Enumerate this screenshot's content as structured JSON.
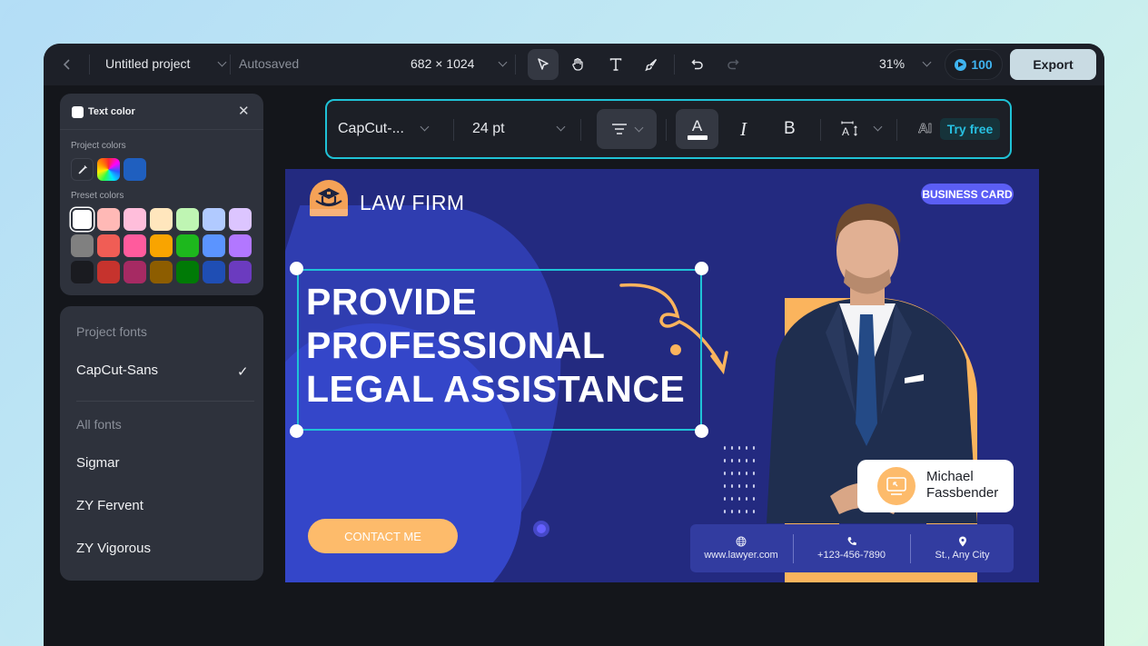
{
  "topbar": {
    "back_label": "‹",
    "project_title": "Untitled project",
    "save_status": "Autosaved",
    "canvas_size": "682 × 1024",
    "tools": [
      {
        "name": "select",
        "icon": "cursor-icon"
      },
      {
        "name": "hand",
        "icon": "hand-icon"
      },
      {
        "name": "text",
        "icon": "text-icon"
      },
      {
        "name": "draw",
        "icon": "brush-icon"
      },
      {
        "name": "undo",
        "icon": "undo-icon"
      },
      {
        "name": "redo",
        "icon": "redo-icon"
      }
    ],
    "zoom_level": "31%",
    "credits": "100",
    "export_label": "Export"
  },
  "text_toolbar": {
    "font": "CapCut-...",
    "size": "24 pt",
    "ai_label": "AI",
    "try_free": "Try free",
    "italic_label": "I",
    "bold_label": "B",
    "color_label": "A"
  },
  "color_panel": {
    "title": "Text color",
    "close": "✕",
    "project_colors_label": "Project colors",
    "project_colors": [
      "eyedropper",
      "gradient",
      "#1f5fbf"
    ],
    "preset_colors_label": "Preset colors",
    "preset_colors": [
      [
        "#ffffff",
        "#ffb9b6",
        "#ffbedb",
        "#ffe6bd",
        "#bff5b3",
        "#b1caff",
        "#dcc5ff"
      ],
      [
        "#808080",
        "#f05d55",
        "#ff5b9d",
        "#f9a400",
        "#1db81d",
        "#5b94ff",
        "#b277ff"
      ],
      [
        "#1a1b20",
        "#c6332d",
        "#a62a63",
        "#8d5d00",
        "#007a06",
        "#1f4eb4",
        "#6b3bbf"
      ]
    ],
    "selected": "#ffffff"
  },
  "font_panel": {
    "project_fonts_label": "Project fonts",
    "project_fonts": [
      {
        "name": "CapCut-Sans",
        "selected": true
      }
    ],
    "all_fonts_label": "All fonts",
    "all_fonts": [
      "Sigmar",
      "ZY Fervent",
      "ZY Vigorous"
    ],
    "check": "✓"
  },
  "canvas": {
    "brand": "LAW FIRM",
    "badge": "BUSINESS CARD",
    "headline": [
      "PROVIDE",
      "PROFESSIONAL",
      "LEGAL ASSISTANCE"
    ],
    "cta": "CONTACT ME",
    "person_name": [
      "Michael",
      "Fassbender"
    ],
    "contacts": [
      {
        "icon": "globe-icon",
        "text": "www.lawyer.com"
      },
      {
        "icon": "phone-icon",
        "text": "+123-456-7890"
      },
      {
        "icon": "location-pin-icon",
        "text": "St., Any City"
      }
    ],
    "colors": {
      "background": "#232a80",
      "accent": "#fbb45d",
      "selection": "#1fc2d6",
      "badge": "#5b5ef5"
    }
  }
}
